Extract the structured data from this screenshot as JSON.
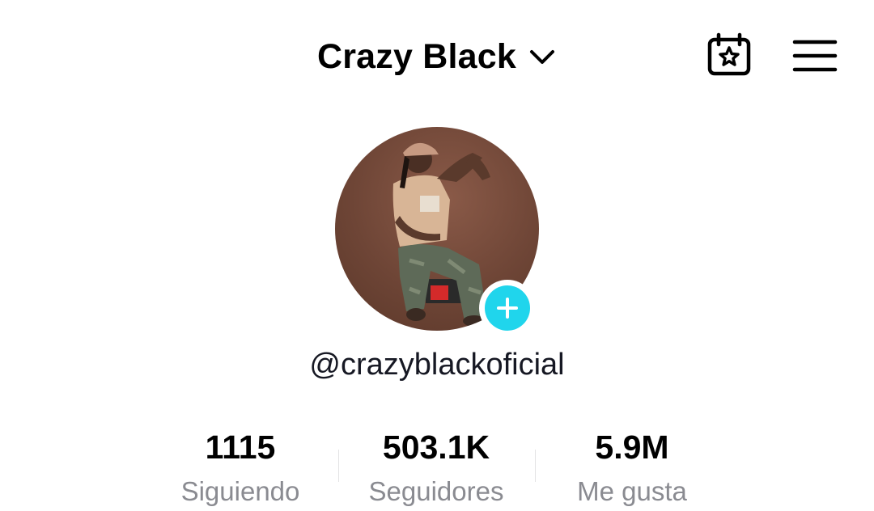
{
  "header": {
    "title": "Crazy Black"
  },
  "profile": {
    "username": "@crazyblackoficial"
  },
  "stats": [
    {
      "value": "1115",
      "label": "Siguiendo"
    },
    {
      "value": "503.1K",
      "label": "Seguidores"
    },
    {
      "value": "5.9M",
      "label": "Me gusta"
    }
  ],
  "icons": {
    "title_dropdown": "chevron-down-icon",
    "calendar": "calendar-star-icon",
    "menu": "hamburger-menu-icon",
    "follow": "plus-icon"
  },
  "colors": {
    "accent": "#20d5ec",
    "text_primary": "#161823",
    "text_secondary": "#8a8b91",
    "avatar_background": "#6e4536"
  }
}
